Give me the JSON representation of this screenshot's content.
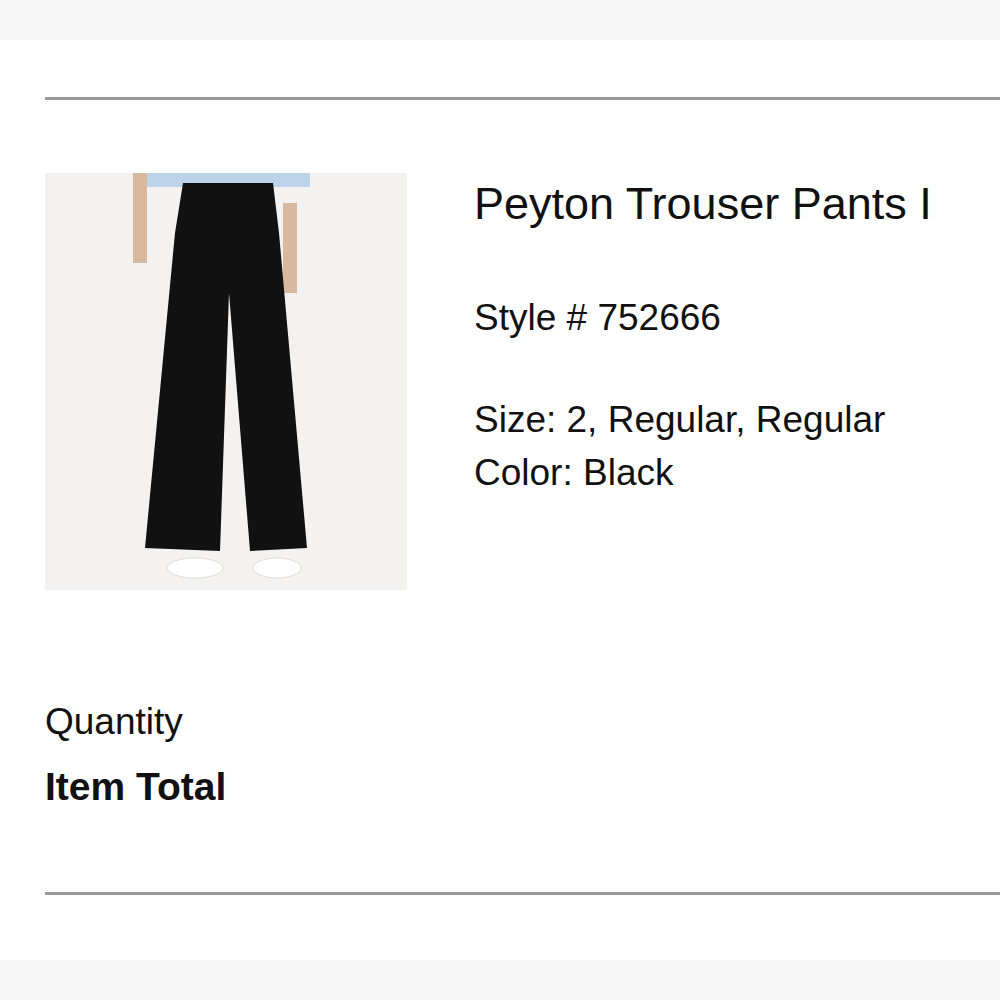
{
  "product": {
    "title": "Peyton Trouser Pants I",
    "style": "Style # 752666",
    "size": "Size: 2, Regular, Regular",
    "color": "Color: Black"
  },
  "summary": {
    "quantity_label": "Quantity",
    "total_label": "Item Total"
  }
}
